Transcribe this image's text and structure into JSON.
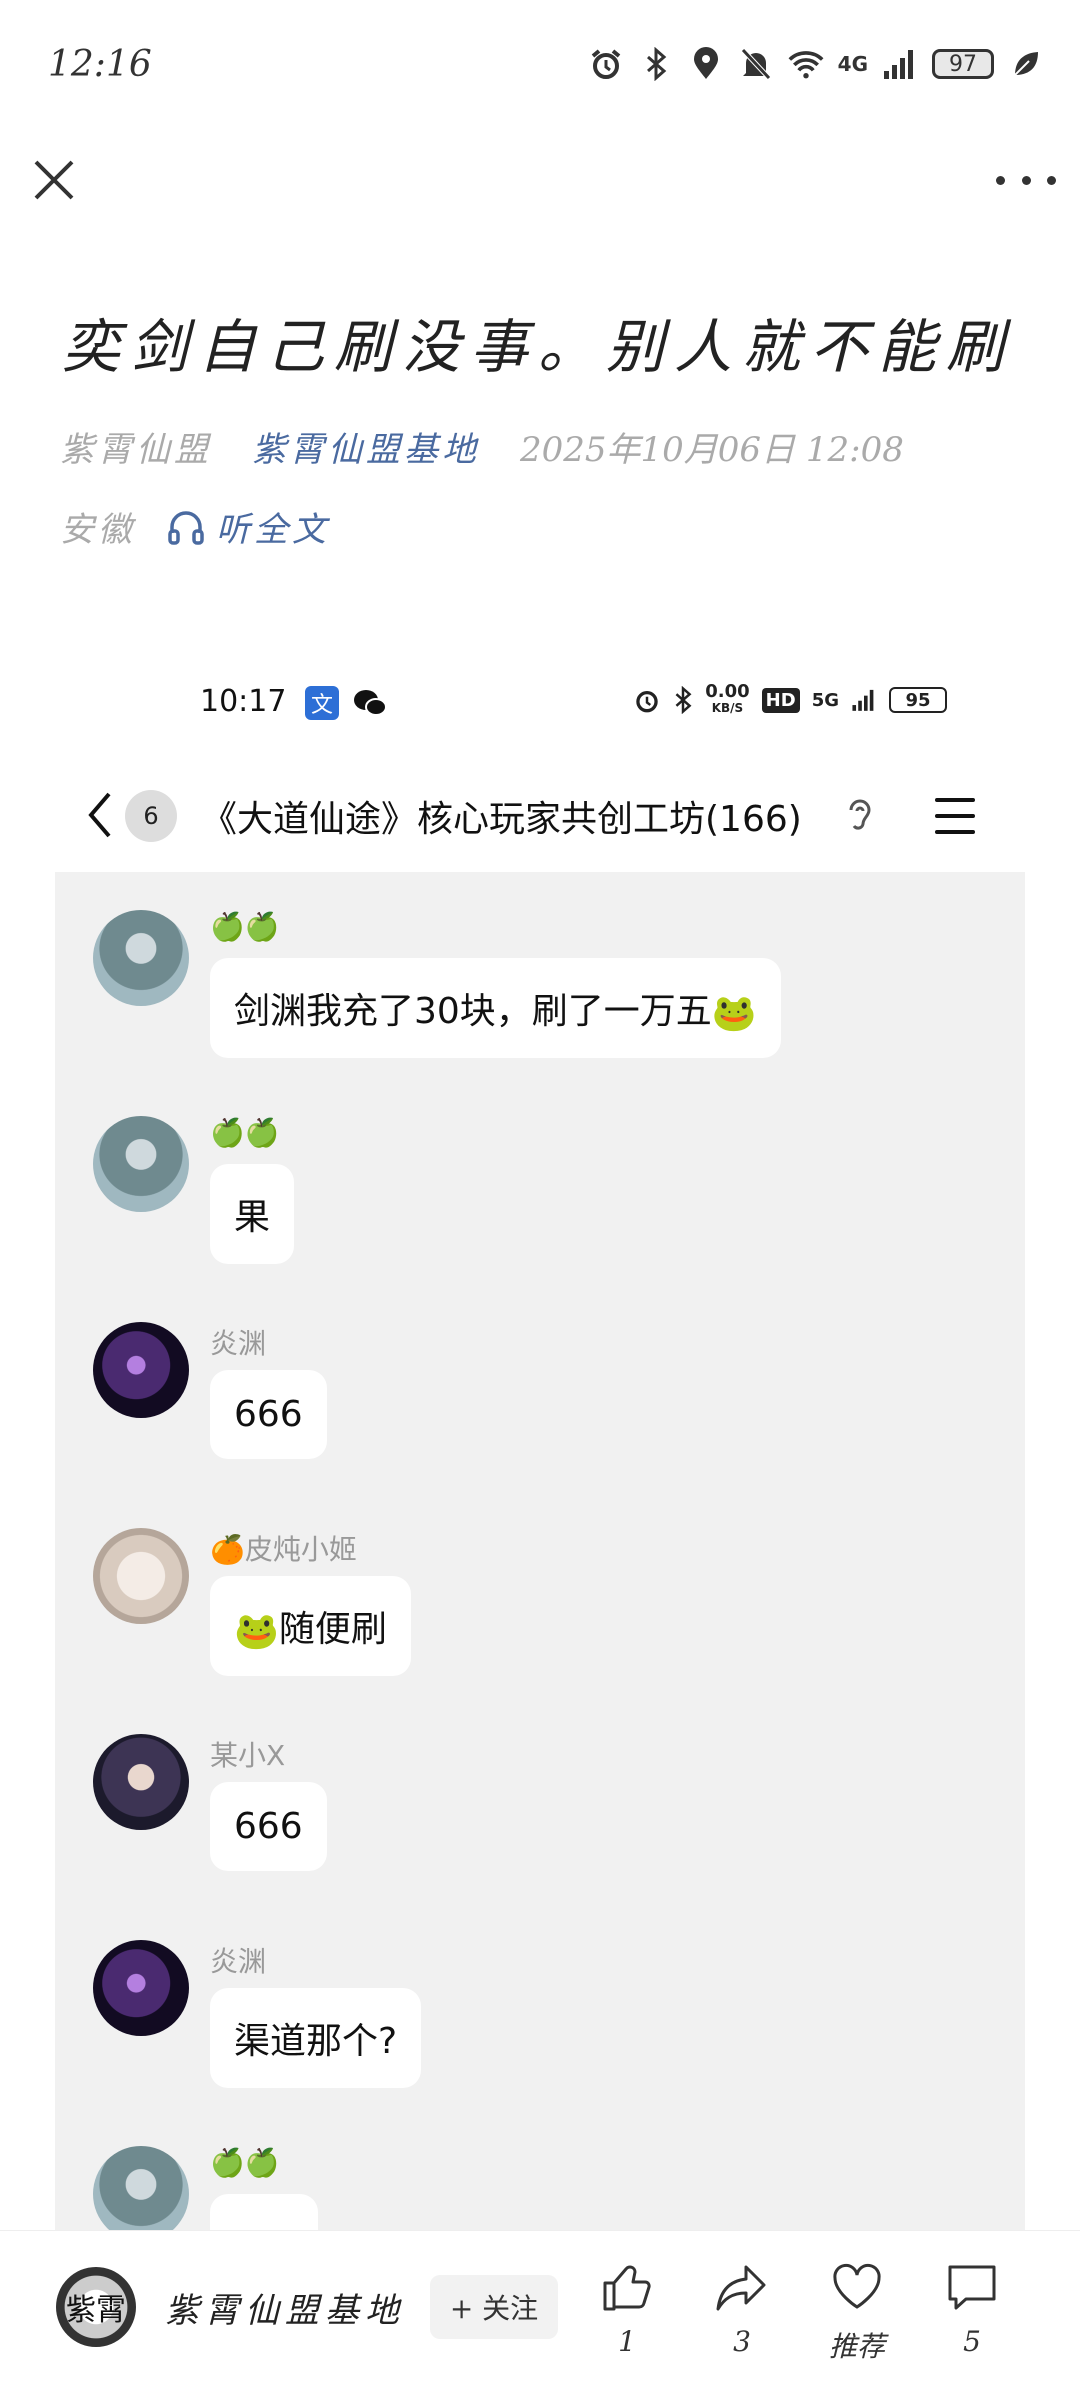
{
  "status_bar": {
    "time": "12:16",
    "network": "4G",
    "battery": "97"
  },
  "article": {
    "title": "奕剑自己刷没事。别人就不能刷",
    "author": "紫霄仙盟",
    "channel": "紫霄仙盟基地",
    "date": "2025年10月06日 12:08",
    "location": "安徽",
    "listen_label": "听全文"
  },
  "screenshot": {
    "status": {
      "time": "10:17",
      "app_badge": "文",
      "speed_value": "0.00",
      "speed_unit": "KB/S",
      "hd_label": "HD",
      "signal_label": "5G",
      "battery": "95"
    },
    "chat": {
      "unread_count": "6",
      "group_title": "《大道仙途》核心玩家共创工坊(166)",
      "messages": [
        {
          "sender": "🍏🍏",
          "text": "剑渊我充了30块，刷了一万五",
          "trail_emoji": "🐸",
          "lead_emoji": ""
        },
        {
          "sender": "🍏🍏",
          "text": "果",
          "trail_emoji": "",
          "lead_emoji": ""
        },
        {
          "sender": "炎渊",
          "text": "666",
          "trail_emoji": "",
          "lead_emoji": ""
        },
        {
          "sender": "🍊皮炖小姬",
          "text": "随便刷",
          "trail_emoji": "",
          "lead_emoji": "🐸"
        },
        {
          "sender": "某小X",
          "text": "666",
          "trail_emoji": "",
          "lead_emoji": ""
        },
        {
          "sender": "炎渊",
          "text": "渠道那个?",
          "trail_emoji": "",
          "lead_emoji": ""
        },
        {
          "sender": "🍏🍏",
          "text": "",
          "trail_emoji": "",
          "lead_emoji": ""
        }
      ]
    }
  },
  "bottom_bar": {
    "avatar_text": "紫霄",
    "account_name": "紫霄仙盟基地",
    "follow_label": "+ 关注",
    "like_count": "1",
    "share_count": "3",
    "recommend_label": "推荐",
    "comment_count": "5"
  },
  "colors": {
    "link": "#4a6aa0",
    "chat_background": "#f1f1f1"
  }
}
